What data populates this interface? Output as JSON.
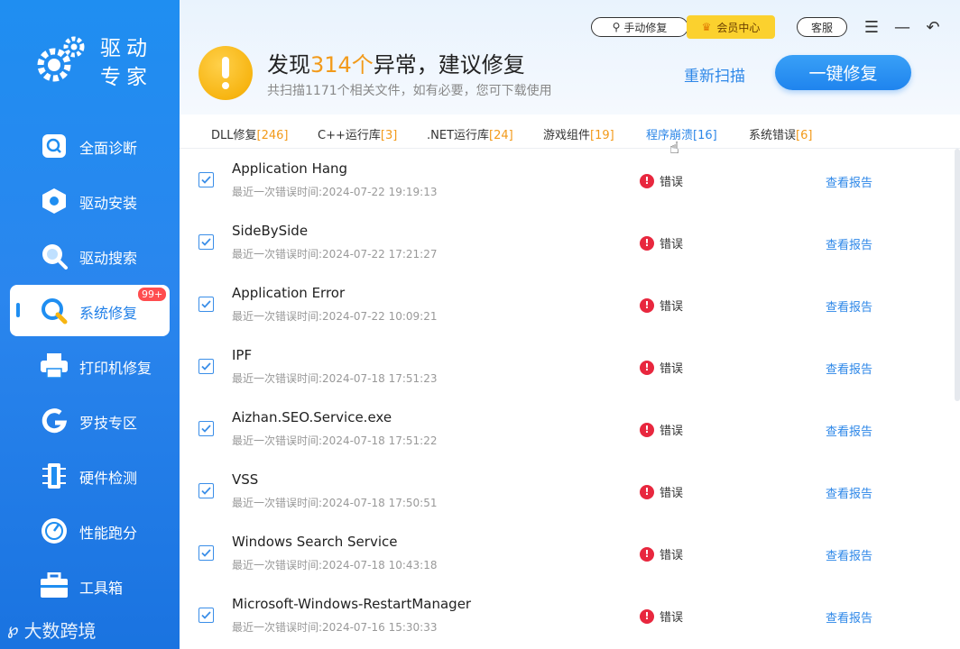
{
  "sidebar": {
    "logo_line1": "驱动",
    "logo_line2": "专家",
    "items": [
      {
        "label": "全面诊断"
      },
      {
        "label": "驱动安装"
      },
      {
        "label": "驱动搜索"
      },
      {
        "label": "系统修复",
        "badge": "99+"
      },
      {
        "label": "打印机修复"
      },
      {
        "label": "罗技专区"
      },
      {
        "label": "硬件检测"
      },
      {
        "label": "性能跑分"
      },
      {
        "label": "工具箱"
      }
    ],
    "watermark": "大数跨境"
  },
  "header": {
    "title_prefix": "发现",
    "title_count": "314个",
    "title_suffix": "异常，建议修复",
    "subtitle": "共扫描1171个相关文件，如有必要，您可下载使用",
    "manual_repair": "手动修复",
    "vip_center": "会员中心",
    "customer_service": "客服",
    "rescan": "重新扫描",
    "one_key_repair": "一键修复"
  },
  "tabs": [
    {
      "label": "DLL修复",
      "count": "[246]"
    },
    {
      "label": "C++运行库",
      "count": "[3]"
    },
    {
      "label": ".NET运行库",
      "count": "[24]"
    },
    {
      "label": "游戏组件",
      "count": "[19]"
    },
    {
      "label": "程序崩溃",
      "count": "[16]"
    },
    {
      "label": "系统错误",
      "count": "[6]"
    }
  ],
  "list": {
    "time_prefix": "最近一次错误时间:",
    "status_label": "错误",
    "report_label": "查看报告",
    "rows": [
      {
        "name": "Application Hang",
        "time": "最近一次错误时间:2024-07-22 19:19:13"
      },
      {
        "name": "SideBySide",
        "time": "最近一次错误时间:2024-07-22 17:21:27"
      },
      {
        "name": "Application Error",
        "time": "最近一次错误时间:2024-07-22 10:09:21"
      },
      {
        "name": "IPF",
        "time": "最近一次错误时间:2024-07-18 17:51:23"
      },
      {
        "name": "Aizhan.SEO.Service.exe",
        "time": "最近一次错误时间:2024-07-18 17:51:22"
      },
      {
        "name": "VSS",
        "time": "最近一次错误时间:2024-07-18 17:50:51"
      },
      {
        "name": "Windows Search Service",
        "time": "最近一次错误时间:2024-07-18 10:43:18"
      },
      {
        "name": "Microsoft-Windows-RestartManager",
        "time": "最近一次错误时间:2024-07-16 15:30:33"
      }
    ]
  },
  "colors": {
    "accent": "#2d87e8",
    "warning": "#f29a1a",
    "error": "#e8273e",
    "sidebar": "#1f8ef1"
  }
}
